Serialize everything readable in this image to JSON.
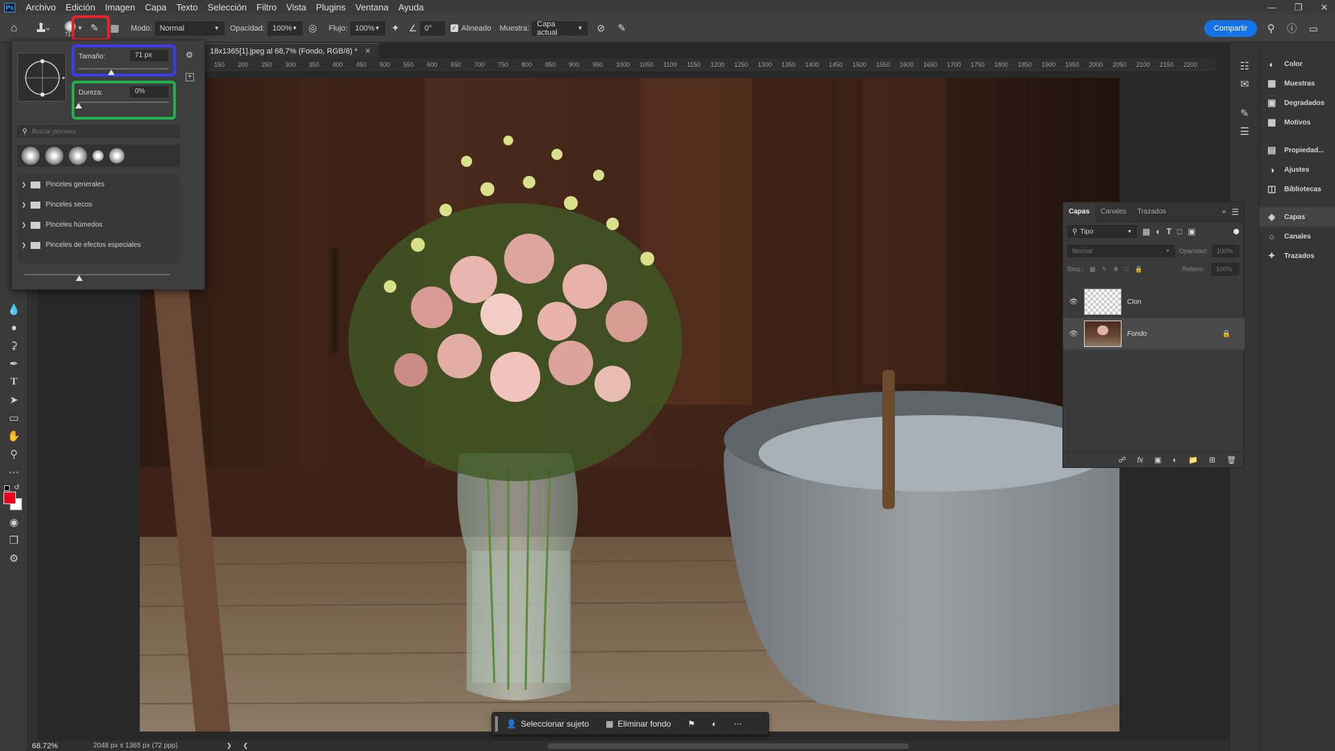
{
  "menubar": {
    "logo": "Ps",
    "items": [
      "Archivo",
      "Edición",
      "Imagen",
      "Capa",
      "Texto",
      "Selección",
      "Filtro",
      "Vista",
      "Plugins",
      "Ventana",
      "Ayuda"
    ]
  },
  "options": {
    "brush_size_badge": "71",
    "mode_label": "Modo:",
    "mode_value": "Normal",
    "opacity_label": "Opacidad:",
    "opacity_value": "100%",
    "flow_label": "Flujo:",
    "flow_value": "100%",
    "angle_value": "0°",
    "aligned_label": "Alineado",
    "sample_label": "Muestra:",
    "sample_value": "Capa actual",
    "share_label": "Compartir"
  },
  "document": {
    "tab_title": "18x1365[1].jpeg al 68,7% (Fondo, RGB/8) *",
    "ruler_ticks": [
      "150",
      "200",
      "250",
      "300",
      "350",
      "400",
      "450",
      "500",
      "550",
      "600",
      "650",
      "700",
      "750",
      "800",
      "850",
      "900",
      "950",
      "1000",
      "1050",
      "1100",
      "1150",
      "1200",
      "1250",
      "1300",
      "1350",
      "1400",
      "1450",
      "1500",
      "1550",
      "1600",
      "1650",
      "1700",
      "1750",
      "1800",
      "1850",
      "1900",
      "1950",
      "2000",
      "2050",
      "2100",
      "2150",
      "2200"
    ]
  },
  "brush_popup": {
    "size_label": "Tamaño:",
    "size_value": "71 px",
    "size_fraction": 0.36,
    "hardness_label": "Dureza:",
    "hardness_value": "0%",
    "hardness_fraction": 0.0,
    "search_placeholder": "Buscar pinceles",
    "folders": [
      "Pinceles generales",
      "Pinceles secos",
      "Pinceles húmedos",
      "Pinceles de efectos especiales"
    ],
    "highlight_colors": {
      "picker": "#e8232d",
      "size": "#3b3be8",
      "hardness": "#21b04b"
    }
  },
  "layers": {
    "tabs": [
      "Capas",
      "Canales",
      "Trazados"
    ],
    "filter_value": "Tipo",
    "blend_value": "Normal",
    "opacity_label": "Opacidad:",
    "opacity_value": "100%",
    "lock_label": "Bloq.:",
    "fill_label": "Relleno:",
    "fill_value": "100%",
    "items": [
      {
        "name": "Clon",
        "visible": true,
        "locked": false
      },
      {
        "name": "Fondo",
        "visible": true,
        "locked": true
      }
    ]
  },
  "dock": {
    "group1": [
      "Color",
      "Muestras",
      "Degradados",
      "Motivos"
    ],
    "group2": [
      "Propiedad...",
      "Ajustes",
      "Bibliotecas"
    ],
    "group3": [
      "Capas",
      "Canales",
      "Trazados"
    ]
  },
  "status": {
    "zoom": "68.72%",
    "doc_info": "2048 px x 1365 px (72 ppp)"
  },
  "context_bar": {
    "select_subject": "Seleccionar sujeto",
    "remove_bg": "Eliminar fondo"
  }
}
